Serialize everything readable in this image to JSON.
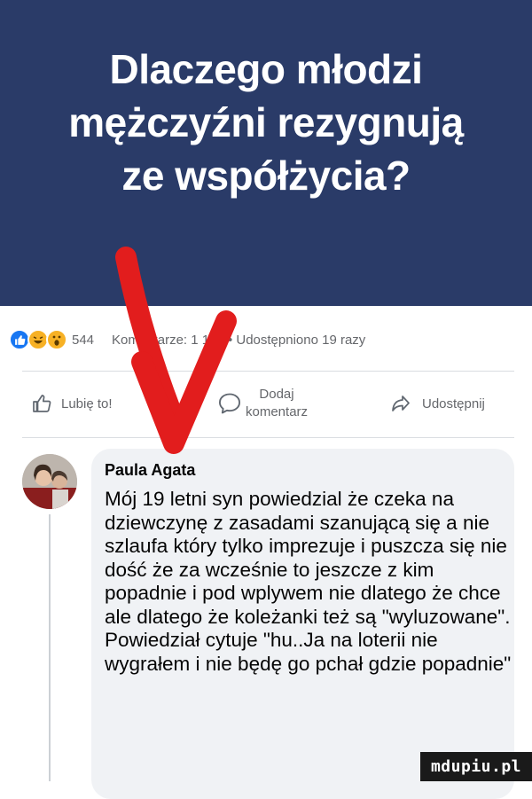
{
  "banner": {
    "title_lines": [
      "Dlaczego młodzi",
      "mężczyźni rezygnują",
      "ze współżycia?"
    ],
    "background": "#2a3b68"
  },
  "stats": {
    "reactions": [
      "like-icon",
      "haha-icon",
      "wow-icon"
    ],
    "reaction_count": "544",
    "comments_and_shares": "Komentarze: 1 139 • Udostępniono 19 razy"
  },
  "actions": {
    "like": {
      "label": "Lubię to!",
      "icon": "thumbs-up-icon"
    },
    "comment": {
      "label_line1": "Dodaj",
      "label_line2": "komentarz",
      "icon": "speech-bubble-icon"
    },
    "share": {
      "label": "Udostępnij",
      "icon": "share-arrow-icon"
    }
  },
  "comment": {
    "author": "Paula Agata",
    "text": "Mój 19 letni syn powiedzial że czeka na dziewczynę z zasadami szanującą się a nie szlaufa który tylko imprezuje i puszcza się nie dość że za wcześnie to jeszcze z kim popadnie i pod wplywem nie dlatego że chce ale dlatego że koleżanki też są \"wyluzowane\". Powiedział cytuje \"hu..Ja  na loterii nie wygrałem i nie będę go pchał gdzie popadnie\""
  },
  "overlay": {
    "arrow_color": "#e21d1d",
    "arrow_icon": "red-down-arrow-icon"
  },
  "watermark": {
    "text": "mdupiu.pl"
  },
  "colors": {
    "facebook_blue": "#1877f2",
    "muted_text": "#65676b",
    "bubble_bg": "#f0f2f5"
  }
}
